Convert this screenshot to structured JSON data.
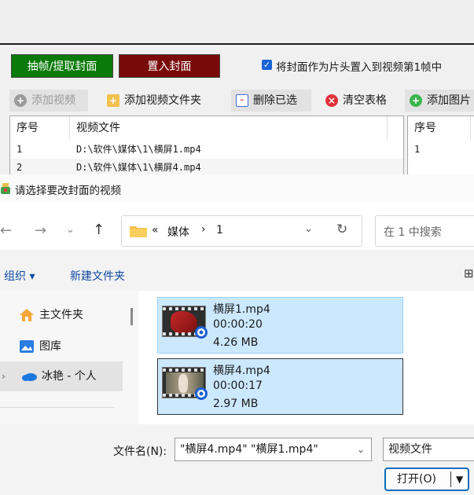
{
  "app": {
    "extract_button": "抽帧/提取封面",
    "replace_button": "置入封面",
    "checkbox_label": "将封面作为片头置入到视频第1帧中",
    "toolbar": [
      "添加视频",
      "添加视频文件夹",
      "删除已选",
      "清空表格",
      "添加图片"
    ],
    "left_table": {
      "headers": [
        "序号",
        "视频文件"
      ],
      "rows": [
        [
          "1",
          "D:\\软件\\媒体\\1\\横屏1.mp4"
        ],
        [
          "2",
          "D:\\软件\\媒体\\1\\横屏4.mp4"
        ]
      ]
    },
    "right_table": {
      "headers": [
        "序号"
      ],
      "rows": [
        [
          "1"
        ]
      ]
    }
  },
  "dialog": {
    "title": "请选择要改封面的视频",
    "breadcrumb": {
      "prefix": "«",
      "parent": "媒体",
      "sep": "›",
      "current": "1"
    },
    "search_placeholder": "在 1 中搜索",
    "cmd": {
      "organize": "组织 ▾",
      "new_folder": "新建文件夹"
    },
    "nav": [
      {
        "label": "主文件夹",
        "icon": "home-icon"
      },
      {
        "label": "图库",
        "icon": "gallery-icon"
      },
      {
        "label": "冰艳 - 个人",
        "icon": "cloud-icon"
      }
    ],
    "files": [
      {
        "name": "横屏1.mp4",
        "duration": "00:00:20",
        "size": "4.26 MB"
      },
      {
        "name": "横屏4.mp4",
        "duration": "00:00:17",
        "size": "2.97 MB"
      }
    ],
    "filename_label": "文件名(N):",
    "filename_value": "\"横屏4.mp4\" \"横屏1.mp4\"",
    "filetype": "视频文件",
    "open_button": "打开(O)"
  }
}
